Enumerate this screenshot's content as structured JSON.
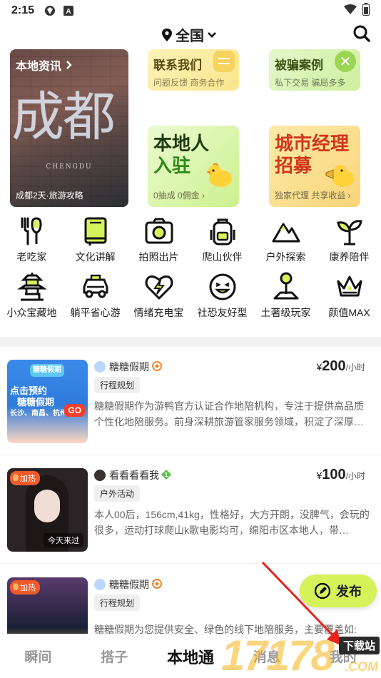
{
  "status": {
    "time": "2:15"
  },
  "header": {
    "location": "全国"
  },
  "top_cards": {
    "local": {
      "title": "本地资讯",
      "big_text": "成都",
      "latin": "CHENGDU",
      "caption": "成都2天·旅游攻略"
    },
    "contact": {
      "title": "联系我们",
      "subtitle": "问题反馈 商务合作"
    },
    "case": {
      "title": "被骗案例",
      "subtitle": "私下交易 骗局多多"
    },
    "join": {
      "line1": "本地人",
      "line2": "入驻",
      "subtitle": "0抽成 0佣金"
    },
    "manager": {
      "line1": "城市经理",
      "line2": "招募",
      "subtitle": "独家代理 共享收益"
    }
  },
  "categories": [
    {
      "label": "老吃家",
      "icon": "fork-knife-icon"
    },
    {
      "label": "文化讲解",
      "icon": "book-icon"
    },
    {
      "label": "拍照出片",
      "icon": "camera-icon"
    },
    {
      "label": "爬山伙伴",
      "icon": "backpack-icon"
    },
    {
      "label": "户外探索",
      "icon": "mountain-icon"
    },
    {
      "label": "康养陪伴",
      "icon": "sprout-icon"
    },
    {
      "label": "小众宝藏地",
      "icon": "pagoda-icon"
    },
    {
      "label": "躺平省心游",
      "icon": "taxi-icon"
    },
    {
      "label": "情绪充电宝",
      "icon": "heart-bolt-icon"
    },
    {
      "label": "社恐友好型",
      "icon": "smile-icon"
    },
    {
      "label": "土著级玩家",
      "icon": "map-pin-icon"
    },
    {
      "label": "颜值MAX",
      "icon": "crown-icon"
    }
  ],
  "listings": [
    {
      "name": "糖糖假期",
      "tag": "行程规划",
      "price_symbol": "¥",
      "price": "200",
      "unit": "/小时",
      "desc": "糖糖假期作为游鸭官方认证合作地陪机构，专注于提供高品质个性化地陪服务。前身深耕旅游管家服务领域，积淀了深厚…",
      "thumb_lines": [
        "糖糖假期",
        "点击预约",
        "糖糖假期",
        "长沙、南昌、杭州…"
      ],
      "thumb_go": "GO"
    },
    {
      "name": "看看看看我",
      "tag": "户外活动",
      "price_symbol": "¥",
      "price": "100",
      "unit": "/小时",
      "desc": "本人00后，156cm,41kg，性格好，大方开朗，没脾气，会玩的很多，运动打球爬山k歌电影均可，绵阳市区本地人，带…",
      "hot": "加热",
      "today": "今天来过"
    },
    {
      "name": "糖糖假期",
      "tag": "行程规划",
      "desc": "糖糖假期为您提供安全、绿色的线下地陪服务，主要覆盖如:",
      "hot": "加热"
    }
  ],
  "publish_label": "发布",
  "bottom_nav": [
    {
      "label": "瞬间",
      "active": false
    },
    {
      "label": "搭子",
      "active": false
    },
    {
      "label": "本地通",
      "active": true
    },
    {
      "label": "消息",
      "active": false
    },
    {
      "label": "我的",
      "active": false
    }
  ],
  "watermark": {
    "text": "17178",
    "sub": "下载站",
    "domain": ".COM"
  },
  "colors": {
    "publish": "#d6f25a",
    "hot": "#f05a2a",
    "accent_green": "#2d8a19",
    "accent_red": "#d0361c"
  }
}
